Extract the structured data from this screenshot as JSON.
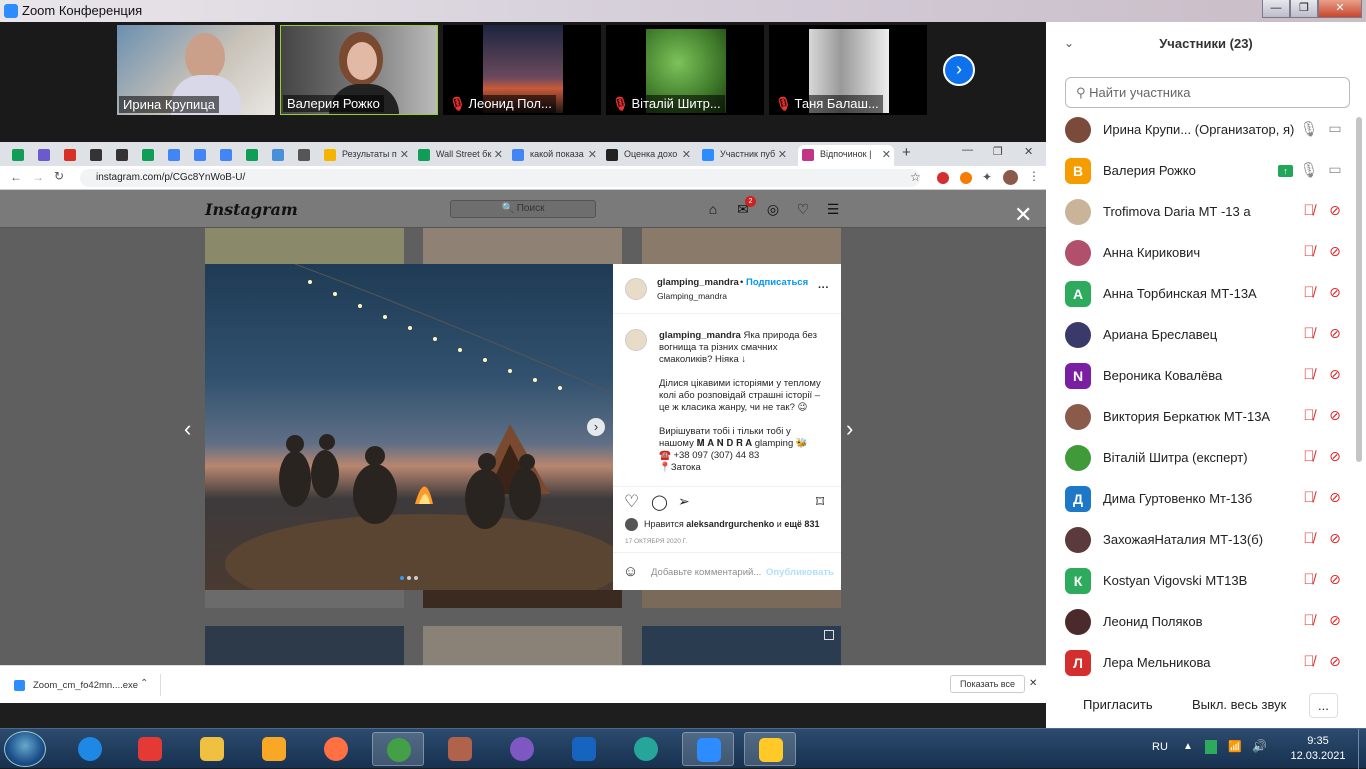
{
  "zoom": {
    "title": "Zoom Конференция",
    "win_min": "—",
    "win_max": "❐",
    "win_close": "✕"
  },
  "gallery": {
    "tiles": [
      {
        "name": "Ирина Крупица",
        "muted": false
      },
      {
        "name": "Валерия Рожко",
        "muted": false
      },
      {
        "name": "Леонид Пол...",
        "muted": true
      },
      {
        "name": "Віталій Шитр...",
        "muted": true
      },
      {
        "name": "Таня Балаш...",
        "muted": true
      }
    ],
    "next_icon": "›"
  },
  "browser": {
    "tabs": [
      {
        "label": "",
        "color": "#0f9d58"
      },
      {
        "label": "",
        "color": "#6a5acd"
      },
      {
        "label": "",
        "color": "#d93025"
      },
      {
        "label": "",
        "color": "#333333"
      },
      {
        "label": "",
        "color": "#333333"
      },
      {
        "label": "",
        "color": "#0f9d58"
      },
      {
        "label": "",
        "color": "#4285f4"
      },
      {
        "label": "",
        "color": "#4285f4"
      },
      {
        "label": "",
        "color": "#4285f4"
      },
      {
        "label": "",
        "color": "#0f9d58"
      },
      {
        "label": "",
        "color": "#4a90d9"
      },
      {
        "label": "",
        "color": "#555555"
      },
      {
        "label": "Результаты п",
        "color": "#f4b400"
      },
      {
        "label": "Wall Street бк",
        "color": "#0f9d58"
      },
      {
        "label": "какой показа",
        "color": "#4285f4"
      },
      {
        "label": "Оценка дохо",
        "color": "#222222"
      },
      {
        "label": "Участник пуб",
        "color": "#2d8cff"
      },
      {
        "label": "Відпочинок |",
        "color": "#c13584"
      }
    ],
    "new_tab": "+",
    "url": "instagram.com/p/CGc8YnWoB-U/",
    "win_min": "—",
    "win_max": "❐",
    "win_close": "✕"
  },
  "instagram": {
    "logo": "Instagram",
    "search_placeholder": "🔍 Поиск",
    "notif_count": "2",
    "post": {
      "username": "glamping_mandra",
      "follow": "Подписаться",
      "dot": "•",
      "subtitle": "Glamping_mandra",
      "more": "···",
      "caption_user": "glamping_mandra",
      "caption_1": "Яка природа без вогнища та різних смачних смаколиків? Ніяка ↓",
      "caption_2": "Ділися цікавими історіями у теплому колі або розповідай страшні історії – це ж класика жанру, чи не так? 😉",
      "caption_3": "Вирішувати тобі і тільки тобі у нашому 𝐌 𝐀 𝐍 𝐃 𝐑 𝐀 glamping 🐝",
      "caption_4": "☎️ +38 097 (307) 44 83",
      "caption_5": "📍Затока",
      "likes_prefix": "Нравится",
      "likes_user": "aleksandrgurchenko",
      "likes_and": "и",
      "likes_more": "ещё 831",
      "date": "17 ОКТЯБРЯ 2020 Г.",
      "comment_placeholder": "Добавьте комментарий...",
      "publish": "Опубликовать"
    },
    "close": "✕",
    "prev": "‹",
    "next": "›"
  },
  "downloads": {
    "file": "Zoom_cm_fo42mn....exe",
    "show_all": "Показать все",
    "close": "✕"
  },
  "participants": {
    "title": "Участники (23)",
    "search_placeholder": "Найти участника",
    "list": [
      {
        "name": "Ирина Крупи...  (Организатор, я)",
        "avatar": "",
        "color": "#7a4a3a",
        "muted": false,
        "cam_off": false
      },
      {
        "name": "Валерия Рожко",
        "avatar": "В",
        "color": "#f59c00",
        "muted": false,
        "cam_off": false,
        "sharing": true
      },
      {
        "name": "Trofimova Daria МТ -13 а",
        "avatar": "",
        "color": "#c9b49a",
        "muted": true,
        "cam_off": true
      },
      {
        "name": "Анна Кирикович",
        "avatar": "",
        "color": "#b0506a",
        "muted": true,
        "cam_off": true
      },
      {
        "name": "Анна Торбинская МТ-13А",
        "avatar": "А",
        "color": "#2eaa5c",
        "muted": true,
        "cam_off": true
      },
      {
        "name": "Ариана Бреславец",
        "avatar": "",
        "color": "#3a3a6a",
        "muted": true,
        "cam_off": true
      },
      {
        "name": "Вероника Ковалёва",
        "avatar": "N",
        "color": "#7b1fa2",
        "muted": true,
        "cam_off": true
      },
      {
        "name": "Виктория Беркатюк МТ-13А",
        "avatar": "",
        "color": "#8a5a4a",
        "muted": true,
        "cam_off": true
      },
      {
        "name": "Віталій Шитра (експерт)",
        "avatar": "",
        "color": "#3f9a3a",
        "muted": true,
        "cam_off": true
      },
      {
        "name": "Дима Гуртовенко Мт-13б",
        "avatar": "Д",
        "color": "#1e78c8",
        "muted": true,
        "cam_off": true
      },
      {
        "name": "ЗахожаяНаталия МТ-13(б)",
        "avatar": "",
        "color": "#5a3a3a",
        "muted": true,
        "cam_off": true
      },
      {
        "name": "Kostyan Vigovski МТ13В",
        "avatar": "К",
        "color": "#2eaa5c",
        "muted": true,
        "cam_off": true
      },
      {
        "name": "Леонид Поляков",
        "avatar": "",
        "color": "#4a2a2a",
        "muted": true,
        "cam_off": true
      },
      {
        "name": "Лера Мельникова",
        "avatar": "Л",
        "color": "#d32f2f",
        "muted": true,
        "cam_off": true
      }
    ],
    "invite": "Пригласить",
    "mute_all": "Выкл. весь звук",
    "more": "..."
  },
  "taskbar": {
    "lang": "RU",
    "time": "9:35",
    "date": "12.03.2021",
    "apps": [
      {
        "name": "ie",
        "color": "#1e88e5"
      },
      {
        "name": "paint",
        "color": "#e53935"
      },
      {
        "name": "explorer",
        "color": "#f0c040"
      },
      {
        "name": "archicad",
        "color": "#f9a825"
      },
      {
        "name": "firefox",
        "color": "#ff7043"
      },
      {
        "name": "chrome",
        "color": "#43a047"
      },
      {
        "name": "colosseum",
        "color": "#b0624a"
      },
      {
        "name": "viber",
        "color": "#7e57c2"
      },
      {
        "name": "word",
        "color": "#1565c0"
      },
      {
        "name": "edge",
        "color": "#26a69a"
      },
      {
        "name": "zoom",
        "color": "#2d8cff"
      },
      {
        "name": "other",
        "color": "#ffca28"
      }
    ]
  }
}
